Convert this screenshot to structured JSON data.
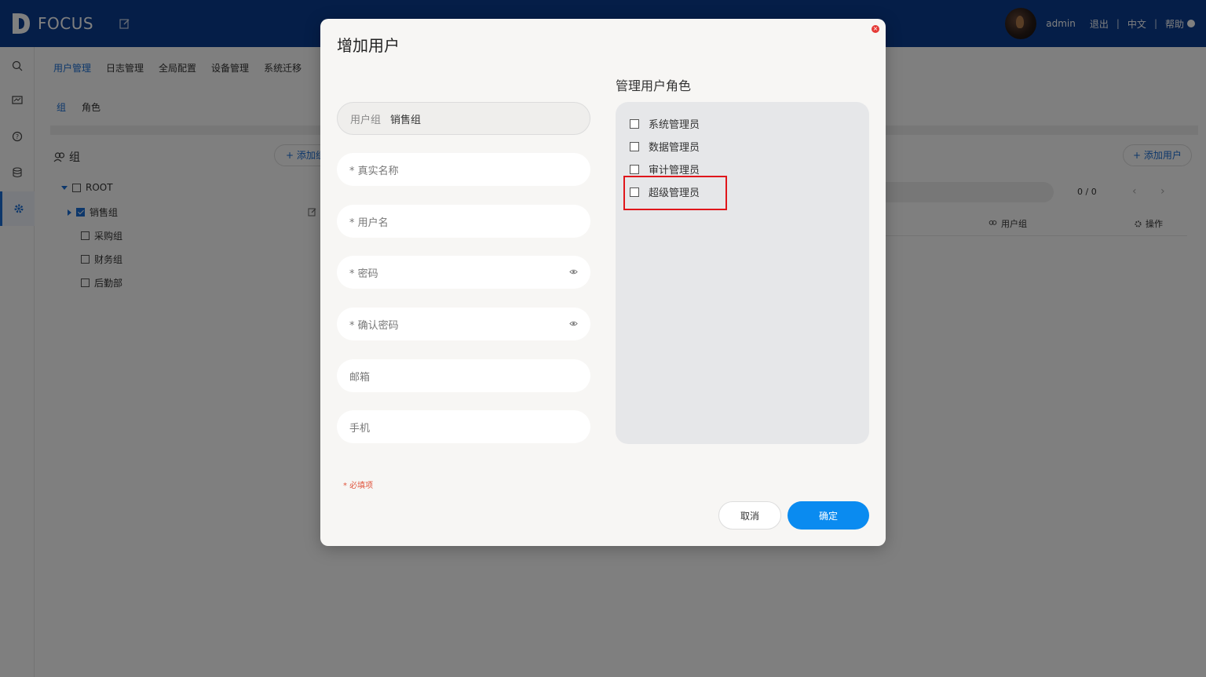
{
  "app": {
    "logo_text": "FOCUS"
  },
  "topbar": {
    "user": "admin",
    "logout": "退出",
    "language": "中文",
    "help": "帮助"
  },
  "nav": {
    "tabs": [
      "用户管理",
      "日志管理",
      "全局配置",
      "设备管理",
      "系统迁移"
    ]
  },
  "subnav": {
    "tabs": [
      "组",
      "角色"
    ]
  },
  "groups": {
    "title": "组",
    "add_label": "+ 添加组",
    "tree": [
      {
        "label": "ROOT",
        "checked": false
      },
      {
        "label": "销售组",
        "checked": true
      },
      {
        "label": "采购组",
        "checked": false
      },
      {
        "label": "财务组",
        "checked": false
      },
      {
        "label": "后勤部",
        "checked": false
      }
    ]
  },
  "users": {
    "add_label": "+ 添加用户",
    "pager": "0 / 0",
    "columns": [
      "用户组",
      "操作"
    ]
  },
  "dialog": {
    "title": "增加用户",
    "group_field": {
      "label": "用户组",
      "value": "销售组"
    },
    "fields": [
      {
        "placeholder": "* 真实名称"
      },
      {
        "placeholder": "* 用户名"
      },
      {
        "placeholder": "* 密码"
      },
      {
        "placeholder": "* 确认密码"
      },
      {
        "placeholder": "邮箱"
      },
      {
        "placeholder": "手机"
      }
    ],
    "required_note": "* 必填项",
    "roles_title": "管理用户角色",
    "roles": [
      "系统管理员",
      "数据管理员",
      "审计管理员",
      "超级管理员"
    ],
    "cancel": "取消",
    "confirm": "确定"
  },
  "colors": {
    "topbar": "#0b3d91",
    "accent": "#1a6fd6",
    "confirm_button": "#0a8bf0",
    "highlight": "#e0161b",
    "required": "#e0553e"
  }
}
